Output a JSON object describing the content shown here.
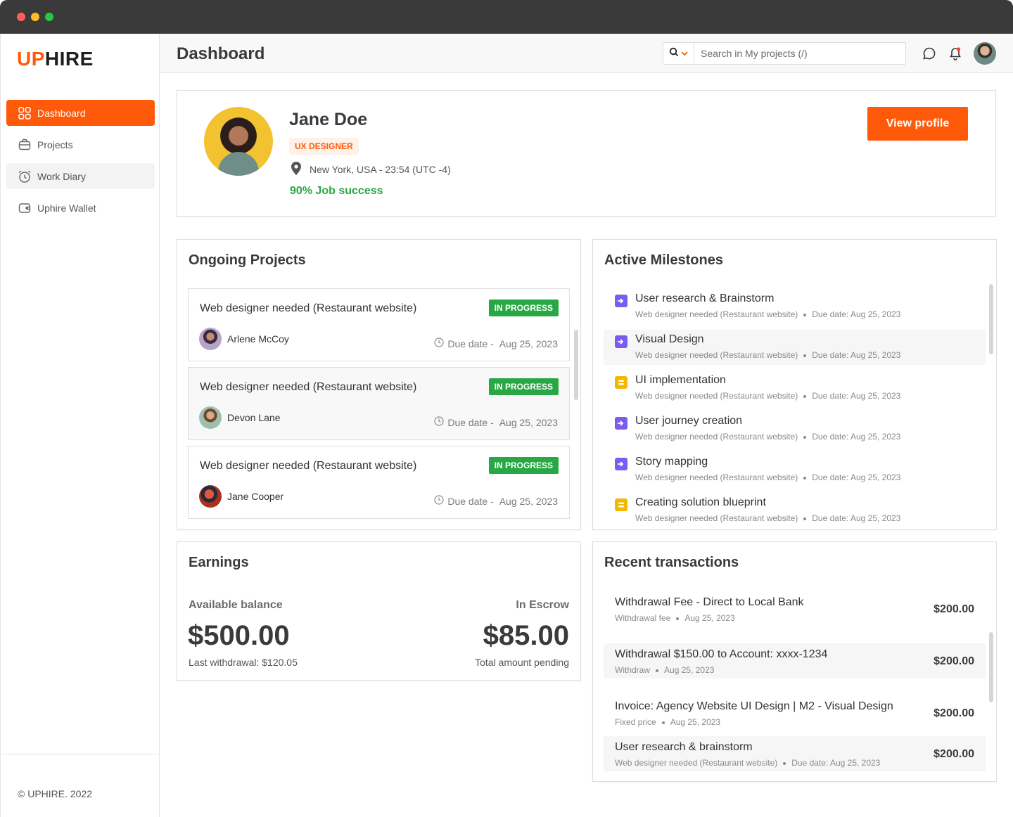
{
  "brand": {
    "logo_accent": "UP",
    "logo_rest": "HIRE",
    "accent_color": "#ff5a0a",
    "success_color": "#27a844"
  },
  "sidebar": {
    "items": [
      {
        "label": "Dashboard",
        "icon": "grid-icon"
      },
      {
        "label": "Projects",
        "icon": "briefcase-icon"
      },
      {
        "label": "Work Diary",
        "icon": "alarm-clock-icon"
      },
      {
        "label": "Uphire Wallet",
        "icon": "wallet-icon"
      }
    ],
    "footer": "© UPHIRE. 2022"
  },
  "header": {
    "title": "Dashboard",
    "search_placeholder": "Search in My projects (/)"
  },
  "profile": {
    "name": "Jane Doe",
    "role": "UX DESIGNER",
    "location": "New York, USA - 23:54 (UTC -4)",
    "job_success": "90% Job success",
    "view_profile": "View profile"
  },
  "ongoing": {
    "title": "Ongoing Projects",
    "projects": [
      {
        "title": "Web designer needed (Restaurant website)",
        "status": "IN PROGRESS",
        "user": "Arlene McCoy",
        "due_label": "Due date -",
        "due": "Aug 25, 2023"
      },
      {
        "title": "Web designer needed (Restaurant website)",
        "status": "IN PROGRESS",
        "user": "Devon Lane",
        "due_label": "Due date -",
        "due": "Aug 25, 2023"
      },
      {
        "title": "Web designer needed (Restaurant website)",
        "status": "IN PROGRESS",
        "user": "Jane Cooper",
        "due_label": "Due date -",
        "due": "Aug 25, 2023"
      }
    ]
  },
  "milestones": {
    "title": "Active Milestones",
    "items": [
      {
        "title": "User research & Brainstorm",
        "project": "Web designer needed (Restaurant website)",
        "due": "Due date: Aug 25, 2023",
        "icon_color": "#7b5cf0"
      },
      {
        "title": "Visual Design",
        "project": "Web designer needed (Restaurant website)",
        "due": "Due date: Aug 25, 2023",
        "icon_color": "#7b5cf0"
      },
      {
        "title": "UI implementation",
        "project": "Web designer needed (Restaurant website)",
        "due": "Due date: Aug 25, 2023",
        "icon_color": "#f5b800"
      },
      {
        "title": "User journey creation",
        "project": "Web designer needed (Restaurant website)",
        "due": "Due date: Aug 25, 2023",
        "icon_color": "#7b5cf0"
      },
      {
        "title": "Story mapping",
        "project": "Web designer needed (Restaurant website)",
        "due": "Due date: Aug 25, 2023",
        "icon_color": "#7b5cf0"
      },
      {
        "title": "Creating solution blueprint",
        "project": "Web designer needed (Restaurant website)",
        "due": "Due date: Aug 25, 2023",
        "icon_color": "#f5b800"
      }
    ]
  },
  "earnings": {
    "title": "Earnings",
    "available_label": "Available balance",
    "available": "$500.00",
    "last_withdrawal": "Last withdrawal: $120.05",
    "escrow_label": "In Escrow",
    "escrow": "$85.00",
    "pending": "Total amount pending"
  },
  "transactions": {
    "title": "Recent transactions",
    "items": [
      {
        "title": "Withdrawal Fee - Direct to Local Bank",
        "type": "Withdrawal fee",
        "date": "Aug 25, 2023",
        "amount": "$200.00"
      },
      {
        "title": "Withdrawal $150.00 to Account: xxxx-1234",
        "type": "Withdraw",
        "date": "Aug 25, 2023",
        "amount": "$200.00"
      },
      {
        "title": "Invoice: Agency Website UI Design | M2 - Visual Design",
        "type": "Fixed price",
        "date": "Aug 25, 2023",
        "amount": "$200.00"
      },
      {
        "title": "User research & brainstorm",
        "type": "Web designer needed (Restaurant website)",
        "date": "Due date: Aug 25, 2023",
        "amount": "$200.00"
      }
    ]
  }
}
